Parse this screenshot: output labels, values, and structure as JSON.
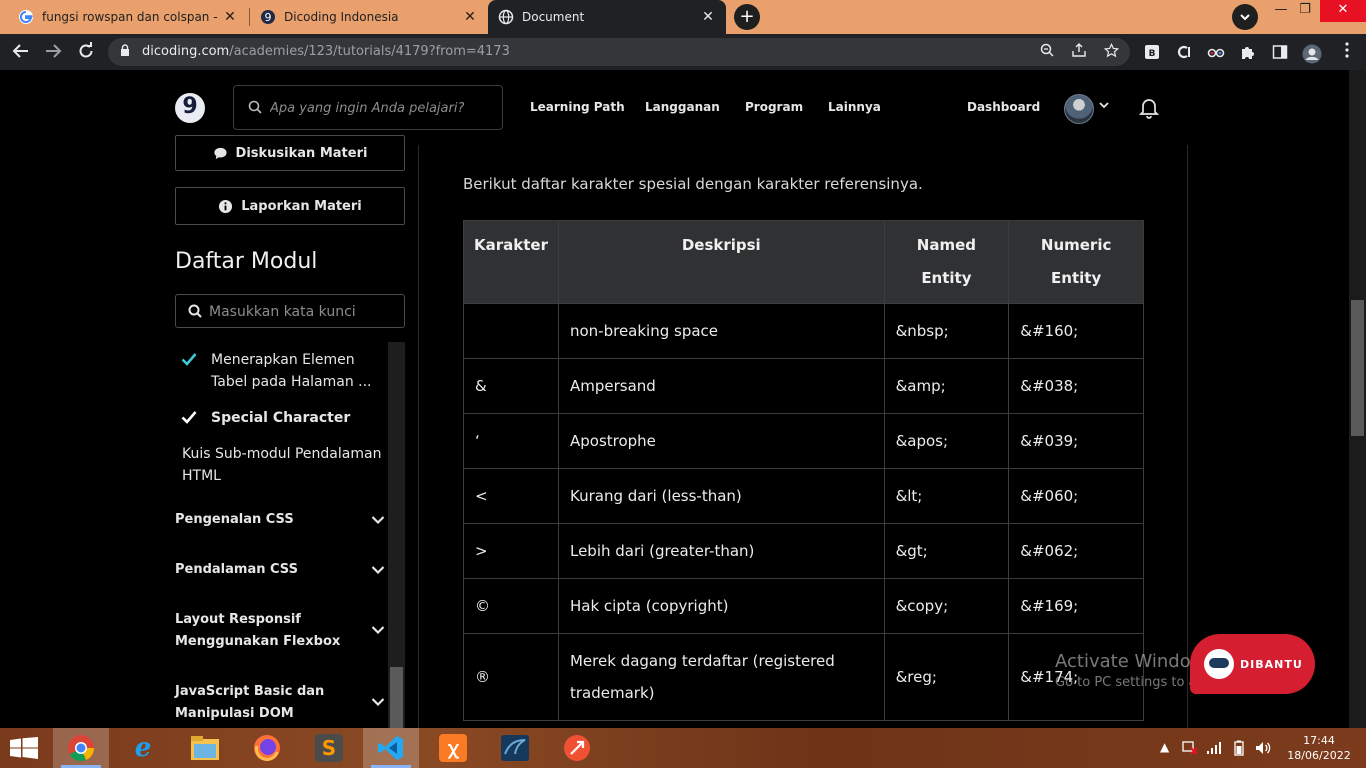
{
  "browser": {
    "tabs": [
      {
        "title": "fungsi rowspan dan colspan - Pe",
        "icon": "google-icon",
        "active": false
      },
      {
        "title": "Dicoding Indonesia",
        "icon": "dicoding-icon",
        "active": false
      },
      {
        "title": "Document",
        "icon": "globe-icon",
        "active": true
      }
    ],
    "new_tab": "+",
    "address": {
      "domain": "dicoding.com",
      "path": "/academies/123/tutorials/4179?from=4173"
    },
    "window_controls": {
      "minimize": "—",
      "maximize": "❐",
      "close": "✕"
    }
  },
  "header": {
    "logo_glyph": "9",
    "search_placeholder": "Apa yang ingin Anda pelajari?",
    "nav": [
      "Learning Path",
      "Langganan",
      "Program",
      "Lainnya"
    ],
    "dashboard": "Dashboard"
  },
  "sidebar": {
    "discuss_button": "Diskusikan Materi",
    "report_button": "Laporkan Materi",
    "modul_title": "Daftar Modul",
    "modul_search_placeholder": "Masukkan kata kunci",
    "items": [
      {
        "label": "Menerapkan Elemen Tabel pada Halaman ...",
        "checked": true,
        "bold": false
      },
      {
        "label": "Special Character",
        "checked": true,
        "bold": true
      },
      {
        "label": "Kuis Sub-modul Pendalaman HTML",
        "checked": false,
        "bold": false
      }
    ],
    "sections": [
      {
        "label": "Pengenalan CSS"
      },
      {
        "label": "Pendalaman CSS"
      },
      {
        "label": "Layout Responsif Menggunakan Flexbox"
      },
      {
        "label": "JavaScript Basic dan Manipulasi DOM"
      }
    ]
  },
  "content": {
    "intro": "Berikut daftar karakter spesial dengan karakter referensinya.",
    "table": {
      "headers": [
        "Karakter",
        "Deskripsi",
        "Named Entity",
        "Numeric Entity"
      ],
      "rows": [
        [
          "",
          "non-breaking space",
          "&nbsp;",
          "&#160;"
        ],
        [
          "&",
          "Ampersand",
          "&amp;",
          "&#038;"
        ],
        [
          "‘",
          "Apostrophe",
          "&apos;",
          "&#039;"
        ],
        [
          "<",
          "Kurang dari (less-than)",
          "&lt;",
          "&#060;"
        ],
        [
          ">",
          "Lebih dari (greater-than)",
          "&gt;",
          "&#062;"
        ],
        [
          "©",
          "Hak cipta (copyright)",
          "&copy;",
          "&#169;"
        ],
        [
          "®",
          "Merek dagang terdaftar (registered trademark)",
          "&reg;",
          "&#174;"
        ]
      ]
    }
  },
  "watermark": {
    "line1": "Activate Windows",
    "line2": "Go to PC settings to activate Windows."
  },
  "dibantu": {
    "label": "DIBANTU"
  },
  "taskbar": {
    "apps": [
      "chrome-icon",
      "internet-explorer-icon",
      "file-explorer-icon",
      "firefox-icon",
      "sublime-text-icon",
      "vscode-icon",
      "xampp-icon",
      "mysql-workbench-icon",
      "git-gui-icon"
    ],
    "time": "17:44",
    "date": "18/06/2022"
  },
  "colors": {
    "tab_strip": "#e9a06d",
    "chrome_dark": "#202124",
    "page_bg": "#000000",
    "table_header": "#2f3133",
    "dibantu_red": "#d51f30",
    "check_teal": "#3fc8d6"
  }
}
